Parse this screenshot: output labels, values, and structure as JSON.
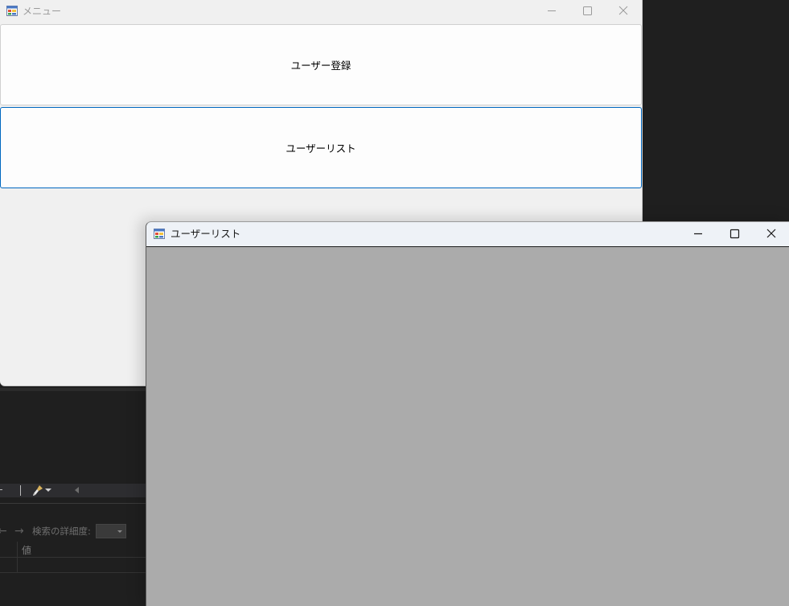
{
  "menu_window": {
    "title": "メニュー",
    "buttons": {
      "user_register": "ユーザー登録",
      "user_list": "ユーザーリスト"
    }
  },
  "userlist_window": {
    "title": "ユーザーリスト"
  },
  "ide_panel": {
    "search_label": "検索の詳細度:",
    "column_value": "値",
    "combo_value": ""
  },
  "colors": {
    "focus_border": "#0067c0",
    "client_gray": "#ababab",
    "ide_dark": "#1f1f1f"
  },
  "icons": {
    "app": "winforms-app-icon",
    "minimize": "minimize-icon",
    "maximize": "maximize-icon",
    "close": "close-icon",
    "brush": "clear-brush-icon",
    "back": "arrow-left-icon",
    "forward": "arrow-right-icon"
  }
}
